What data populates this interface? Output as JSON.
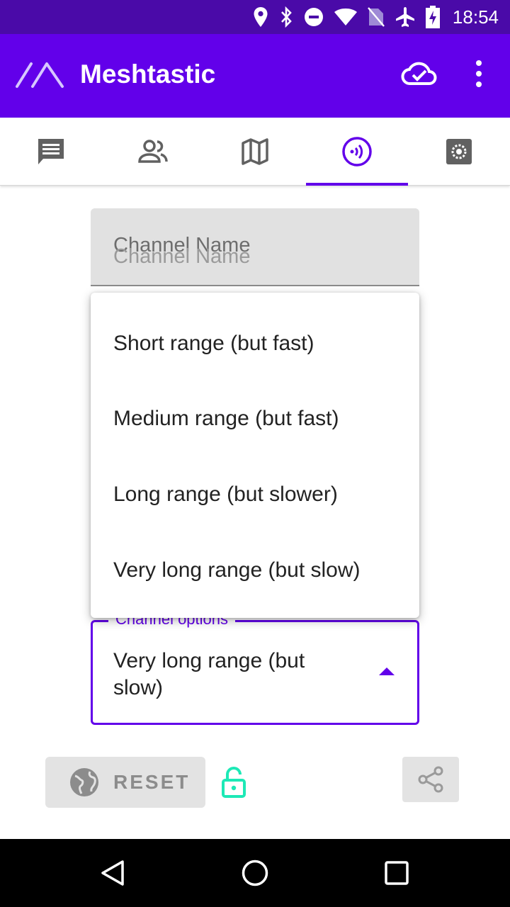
{
  "status_bar": {
    "time": "18:54",
    "icons": [
      "location-icon",
      "bluetooth-icon",
      "do-not-disturb-icon",
      "wifi-icon",
      "no-sim-icon",
      "airplane-mode-icon",
      "battery-charging-icon"
    ]
  },
  "app_bar": {
    "title": "Meshtastic",
    "icons": [
      "meshtastic-logo",
      "cloud-check-icon",
      "more-vert-icon"
    ]
  },
  "tabs": [
    {
      "icon": "messages-icon",
      "active": false
    },
    {
      "icon": "users-icon",
      "active": false
    },
    {
      "icon": "map-icon",
      "active": false
    },
    {
      "icon": "channel-radio-icon",
      "active": true
    },
    {
      "icon": "settings-icon",
      "active": false
    }
  ],
  "channel_name_field": {
    "label": "Channel Name",
    "hint": "Channel Name"
  },
  "channel_options": {
    "legend": "Channel options",
    "selected": "Very long range (but slow)",
    "menu_items": [
      "Short range (but fast)",
      "Medium range (but fast)",
      "Long range (but slower)",
      "Very long range (but slow)"
    ]
  },
  "actions": {
    "reset_label": "RESET",
    "lock_icon": "lock-open-icon",
    "share_icon": "share-icon"
  },
  "nav_bar": {
    "icons": [
      "back-icon",
      "home-icon",
      "recents-icon"
    ]
  },
  "colors": {
    "primary": "#6200ea",
    "status_bar": "#4a0aa8",
    "lock_accent": "#1de9b6"
  }
}
